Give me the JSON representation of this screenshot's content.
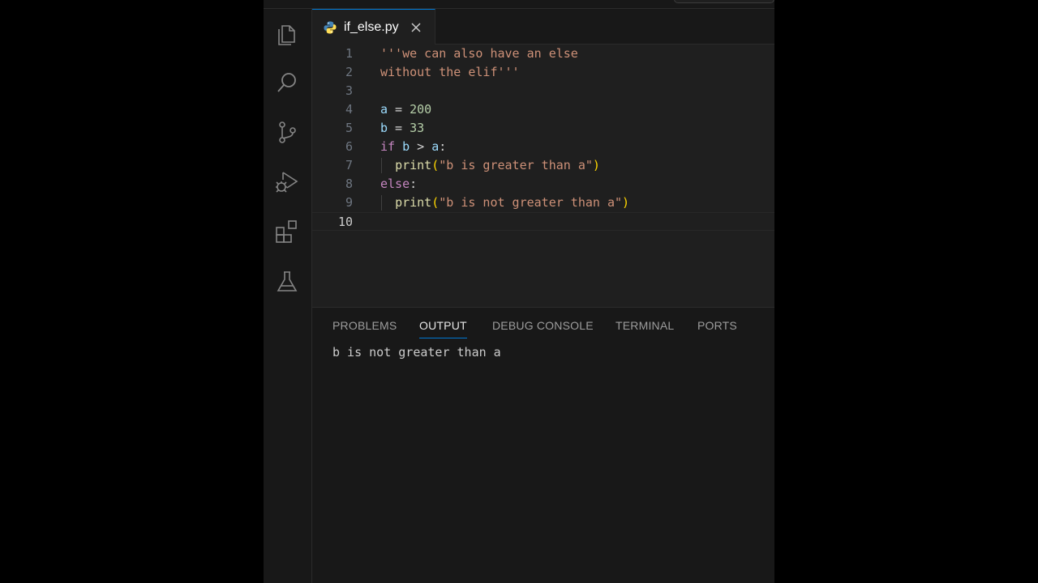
{
  "tab": {
    "filename": "if_else.py"
  },
  "activity_bar": {
    "items": [
      "explorer",
      "search",
      "source-control",
      "run-and-debug",
      "extensions",
      "testing"
    ]
  },
  "editor": {
    "line_numbers": [
      "1",
      "2",
      "3",
      "4",
      "5",
      "6",
      "7",
      "8",
      "9",
      "10"
    ],
    "active_line": "10",
    "lines": [
      [
        {
          "t": "'''we can also have an else",
          "c": "str"
        }
      ],
      [
        {
          "t": "without the elif'''",
          "c": "str"
        }
      ],
      [],
      [
        {
          "t": "a",
          "c": "var"
        },
        {
          "t": " = ",
          "c": "op"
        },
        {
          "t": "200",
          "c": "num"
        }
      ],
      [
        {
          "t": "b",
          "c": "var"
        },
        {
          "t": " = ",
          "c": "op"
        },
        {
          "t": "33",
          "c": "num"
        }
      ],
      [
        {
          "t": "if",
          "c": "kw"
        },
        {
          "t": " ",
          "c": "op"
        },
        {
          "t": "b",
          "c": "var"
        },
        {
          "t": " > ",
          "c": "op"
        },
        {
          "t": "a",
          "c": "var"
        },
        {
          "t": ":",
          "c": "op"
        }
      ],
      [
        {
          "t": "  ",
          "c": "op"
        },
        {
          "t": "print",
          "c": "fn"
        },
        {
          "t": "(",
          "c": "paren"
        },
        {
          "t": "\"b is greater than a\"",
          "c": "str"
        },
        {
          "t": ")",
          "c": "paren"
        }
      ],
      [
        {
          "t": "else",
          "c": "kw"
        },
        {
          "t": ":",
          "c": "op"
        }
      ],
      [
        {
          "t": "  ",
          "c": "op"
        },
        {
          "t": "print",
          "c": "fn"
        },
        {
          "t": "(",
          "c": "paren"
        },
        {
          "t": "\"b is not greater than a\"",
          "c": "str"
        },
        {
          "t": ")",
          "c": "paren"
        }
      ],
      []
    ]
  },
  "panel": {
    "tabs": [
      "PROBLEMS",
      "OUTPUT",
      "DEBUG CONSOLE",
      "TERMINAL",
      "PORTS"
    ],
    "active_tab": "OUTPUT",
    "output": "b is not greater than a"
  },
  "colors": {
    "accent": "#0078d4",
    "string": "#ce9178",
    "keyword": "#c586c0",
    "number": "#b5cea8",
    "variable": "#9cdcfe",
    "function": "#dcdcaa"
  }
}
